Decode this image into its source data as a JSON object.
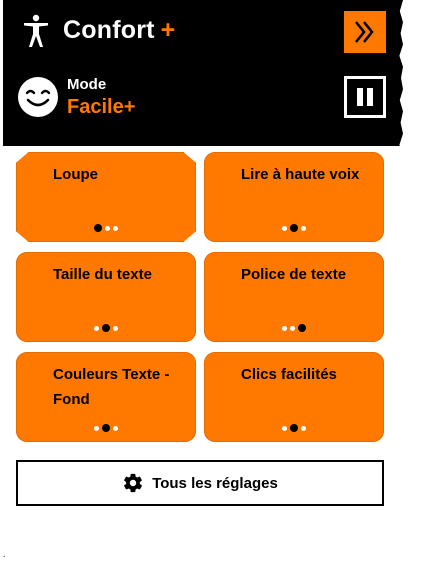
{
  "header": {
    "title": "Confort",
    "title_plus": "+",
    "mode_label": "Mode",
    "mode_value": "Facile+",
    "accent_color": "#ff7900",
    "icons": {
      "accessibility": "accessibility-person-icon",
      "expand": "double-chevron-right-icon",
      "smiley": "smiley-face-icon",
      "pause": "pause-icon"
    }
  },
  "tiles": [
    {
      "label": "Loupe",
      "dots": [
        true,
        false,
        false
      ]
    },
    {
      "label": "Lire à haute voix",
      "dots": [
        false,
        true,
        false
      ]
    },
    {
      "label": "Taille du texte",
      "dots": [
        false,
        true,
        false
      ]
    },
    {
      "label": "Police de texte",
      "dots": [
        false,
        false,
        true
      ]
    },
    {
      "label": "Couleurs Texte - Fond",
      "dots": [
        false,
        true,
        false
      ]
    },
    {
      "label": "Clics facilités",
      "dots": [
        false,
        true,
        false
      ]
    }
  ],
  "settings": {
    "label": "Tous les réglages",
    "icon": "gear-icon"
  }
}
